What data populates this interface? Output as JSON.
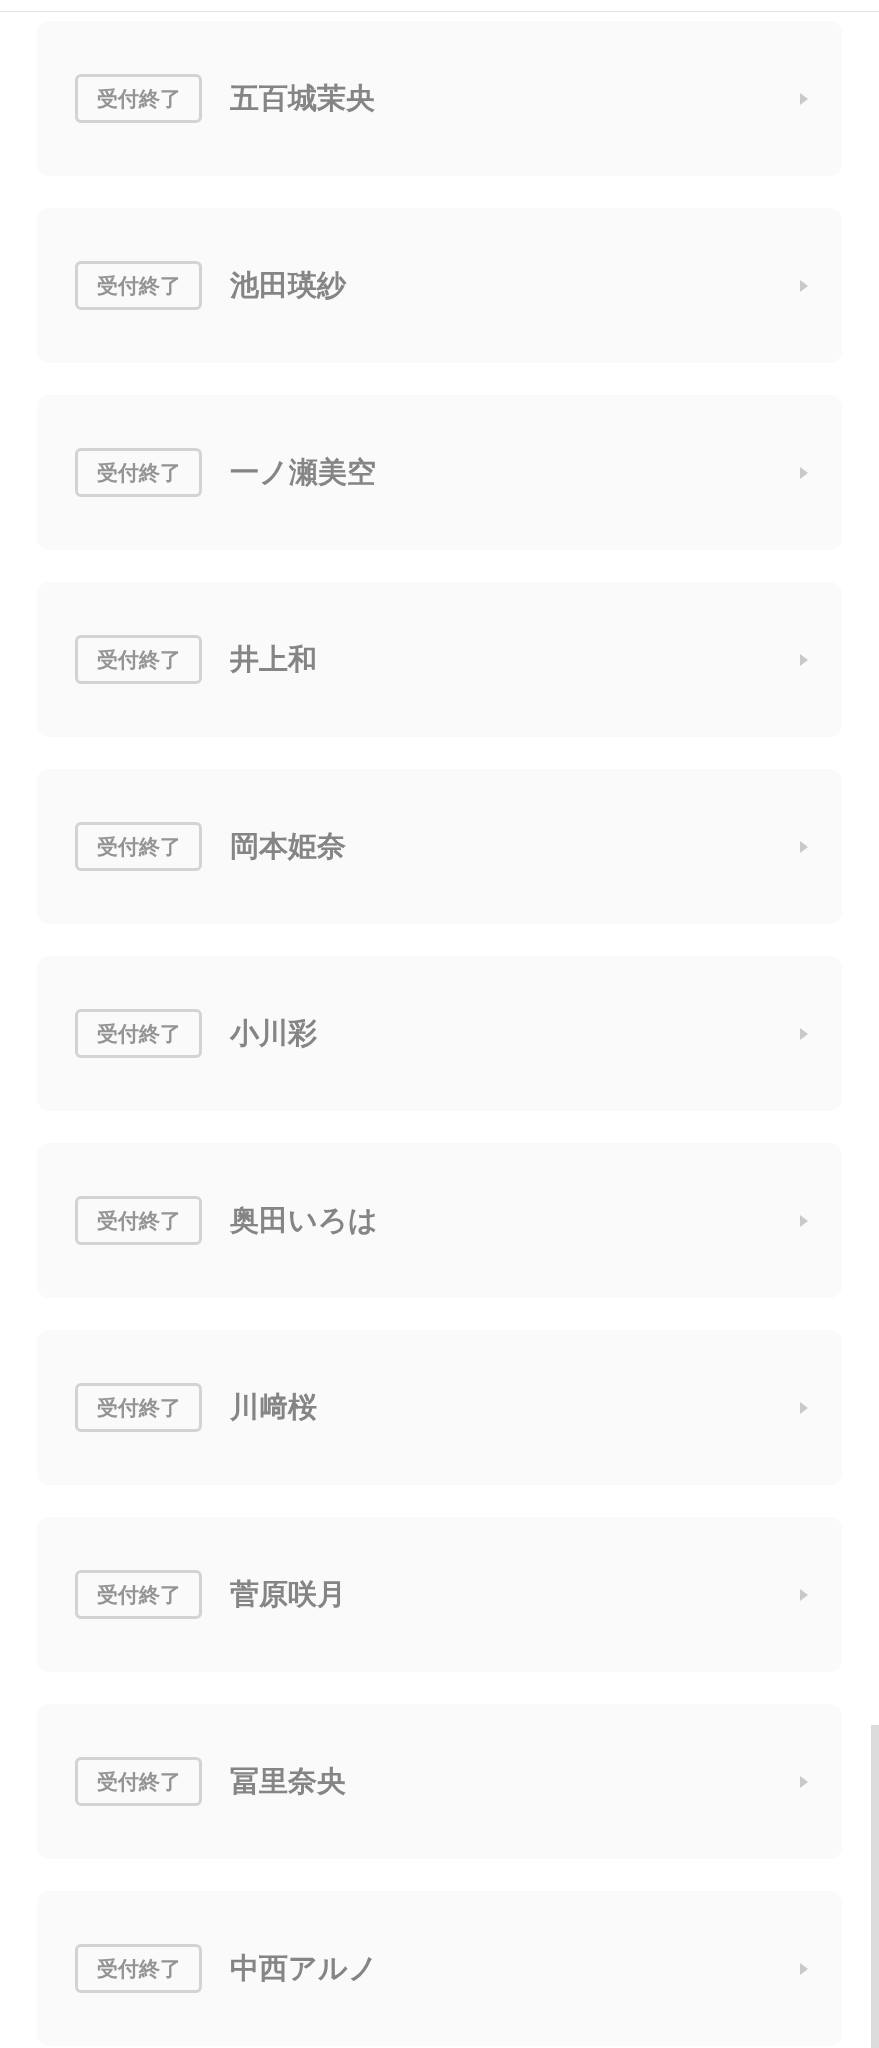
{
  "entries": [
    {
      "status": "受付終了",
      "name": "五百城茉央"
    },
    {
      "status": "受付終了",
      "name": "池田瑛紗"
    },
    {
      "status": "受付終了",
      "name": "一ノ瀬美空"
    },
    {
      "status": "受付終了",
      "name": "井上和"
    },
    {
      "status": "受付終了",
      "name": "岡本姫奈"
    },
    {
      "status": "受付終了",
      "name": "小川彩"
    },
    {
      "status": "受付終了",
      "name": "奥田いろは"
    },
    {
      "status": "受付終了",
      "name": "川﨑桜"
    },
    {
      "status": "受付終了",
      "name": "菅原咲月"
    },
    {
      "status": "受付終了",
      "name": "冨里奈央"
    },
    {
      "status": "受付終了",
      "name": "中西アルノ"
    }
  ]
}
